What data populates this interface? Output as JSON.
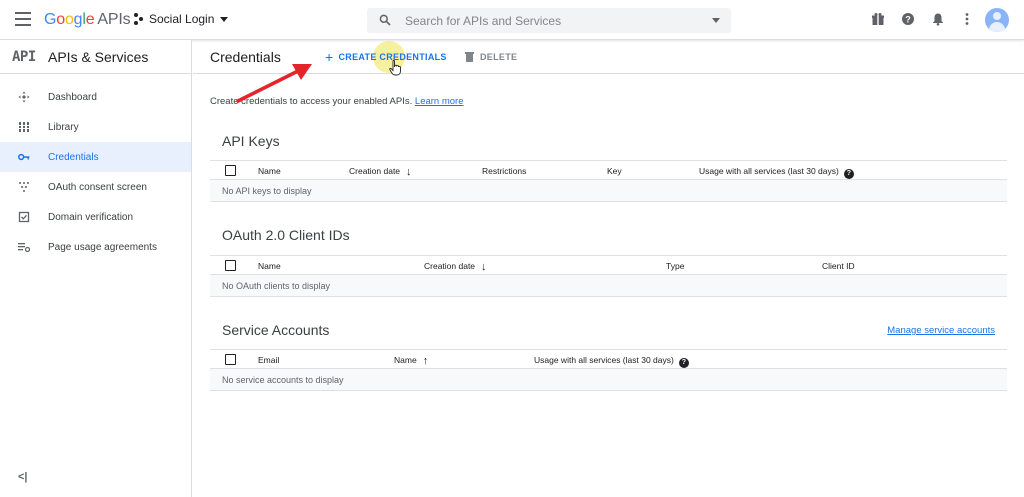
{
  "header": {
    "logo": {
      "g1": "G",
      "o1": "o",
      "o2": "o",
      "g2": "g",
      "l": "l",
      "e": "e",
      "apis": "APIs"
    },
    "project_name": "Social Login",
    "search_placeholder": "Search for APIs and Services",
    "icons": [
      "gift-icon",
      "help-icon",
      "notifications-icon",
      "more-vert-icon",
      "account-avatar"
    ]
  },
  "sidebar": {
    "logo": "API",
    "title": "APIs & Services",
    "items": [
      {
        "label": "Dashboard",
        "icon": "dashboard-icon",
        "active": false
      },
      {
        "label": "Library",
        "icon": "library-icon",
        "active": false
      },
      {
        "label": "Credentials",
        "icon": "key-icon",
        "active": true
      },
      {
        "label": "OAuth consent screen",
        "icon": "consent-icon",
        "active": false
      },
      {
        "label": "Domain verification",
        "icon": "domain-icon",
        "active": false
      },
      {
        "label": "Page usage agreements",
        "icon": "settings-list-icon",
        "active": false
      }
    ],
    "collapse_label": "<|"
  },
  "toolbar": {
    "title": "Credentials",
    "create_label": "CREATE CREDENTIALS",
    "delete_label": "DELETE"
  },
  "intro": {
    "text": "Create credentials to access your enabled APIs.",
    "link": "Learn more"
  },
  "api_keys": {
    "title": "API Keys",
    "columns": [
      "Name",
      "Creation date",
      "Restrictions",
      "Key",
      "Usage with all services (last 30 days)"
    ],
    "empty": "No API keys to display"
  },
  "oauth": {
    "title": "OAuth 2.0 Client IDs",
    "columns": [
      "Name",
      "Creation date",
      "Type",
      "Client ID"
    ],
    "empty": "No OAuth clients to display"
  },
  "service_accounts": {
    "title": "Service Accounts",
    "manage_link": "Manage service accounts",
    "columns": [
      "Email",
      "Name",
      "Usage with all services (last 30 days)"
    ],
    "empty": "No service accounts to display"
  },
  "colors": {
    "accent": "#1a73e8",
    "annotation_arrow": "#e3252a",
    "click_highlight": "#f0e650"
  }
}
